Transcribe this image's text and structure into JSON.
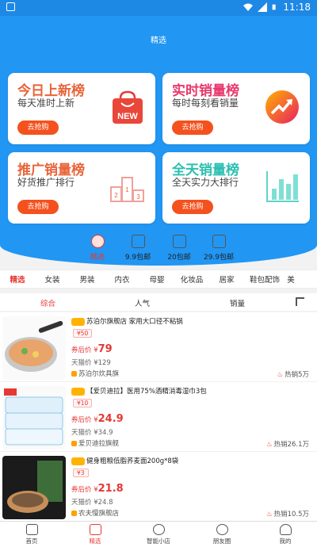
{
  "status_bar": {
    "time": "11:18"
  },
  "header": {
    "title": "精选"
  },
  "cards": [
    {
      "title": "今日上新榜",
      "subtitle": "每天准时上新",
      "button": "去抢购",
      "title_color": "#e8643a",
      "icon": "shopping-bag-new-icon",
      "icon_text": "NEW"
    },
    {
      "title": "实时销量榜",
      "subtitle": "每时每刻看销量",
      "button": "去抢购",
      "title_color": "#e8386d",
      "icon": "trend-arrow-icon"
    },
    {
      "title": "推广销量榜",
      "subtitle": "好货推广排行",
      "button": "去抢购",
      "title_color": "#e8643a",
      "icon": "podium-icon"
    },
    {
      "title": "全天销量榜",
      "subtitle": "全天实力大排行",
      "button": "去抢购",
      "title_color": "#2bbfb0",
      "icon": "bar-chart-icon"
    }
  ],
  "category_icons": [
    {
      "label": "精选",
      "active": true
    },
    {
      "label": "9.9包邮"
    },
    {
      "label": "20包邮"
    },
    {
      "label": "29.9包邮"
    }
  ],
  "tabs": [
    "精选",
    "女装",
    "男装",
    "内衣",
    "母婴",
    "化妆品",
    "居家",
    "鞋包配饰",
    "美"
  ],
  "sort": {
    "items": [
      "综合",
      "人气",
      "销量"
    ],
    "active": "综合"
  },
  "products": [
    {
      "name": "苏泊尔旗舰店 家用大口径不粘锅",
      "coupon": "¥50",
      "after_label": "券后价 ¥",
      "price": "79",
      "tmall_price": "天猫价 ¥129",
      "shop": "苏泊尔炊具旗",
      "sold": "热销5万"
    },
    {
      "name": "【爱贝迪拉】医用75%酒精消毒湿巾3包",
      "coupon": "¥10",
      "after_label": "券后价 ¥",
      "price": "24.9",
      "tmall_price": "天猫价 ¥34.9",
      "shop": "爱贝迪拉旗舰",
      "sold": "热销26.1万"
    },
    {
      "name": "健身粗粮低脂荞麦面200g*8袋",
      "coupon": "¥3",
      "after_label": "券后价 ¥",
      "price": "21.8",
      "tmall_price": "天猫价 ¥24.8",
      "shop": "农夫慢旗舰店",
      "sold": "热销10.5万"
    }
  ],
  "bottom_nav": [
    {
      "label": "首页",
      "icon": "home-icon"
    },
    {
      "label": "精选",
      "icon": "box-icon",
      "active": true
    },
    {
      "label": "智能小店",
      "icon": "target-icon"
    },
    {
      "label": "朋友圈",
      "icon": "chat-bubble-icon"
    },
    {
      "label": "我的",
      "icon": "person-icon"
    }
  ],
  "colors": {
    "primary_blue": "#2196f3",
    "accent_red": "#e53935",
    "button_orange": "#f4511e"
  }
}
